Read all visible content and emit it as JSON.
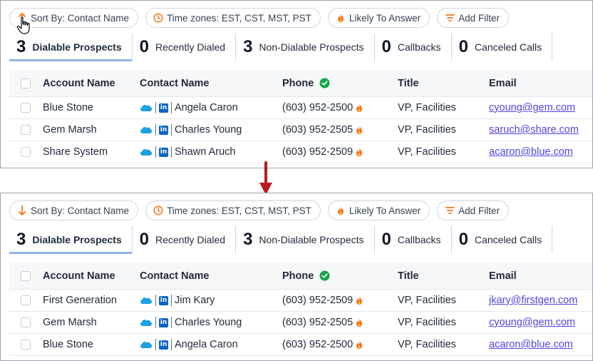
{
  "filters": {
    "sort_label": "Sort By: Contact Name",
    "timezones_label": "Time zones: EST, CST, MST, PST",
    "likely_label": "Likely To Answer",
    "add_filter_label": "Add Filter"
  },
  "tabs": [
    {
      "count": "3",
      "label": "Dialable Prospects"
    },
    {
      "count": "0",
      "label": "Recently Dialed"
    },
    {
      "count": "3",
      "label": "Non-Dialable Prospects"
    },
    {
      "count": "0",
      "label": "Callbacks"
    },
    {
      "count": "0",
      "label": "Canceled Calls"
    }
  ],
  "columns": {
    "account": "Account Name",
    "contact": "Contact Name",
    "phone": "Phone",
    "title": "Title",
    "email": "Email"
  },
  "before": {
    "rows": [
      {
        "account": "Blue Stone",
        "contact": "Angela Caron",
        "phone": "(603) 952-2500",
        "title": "VP, Facilities",
        "email": "cyoung@gem.com"
      },
      {
        "account": "Gem Marsh",
        "contact": "Charles Young",
        "phone": "(603) 952-2505",
        "title": "VP, Facilities",
        "email": "saruch@share.com"
      },
      {
        "account": "Share System",
        "contact": "Shawn Aruch",
        "phone": "(603) 952-2509",
        "title": "VP, Facilities",
        "email": "acaron@blue.com"
      }
    ]
  },
  "after": {
    "rows": [
      {
        "account": "First Generation",
        "contact": "Jim Kary",
        "phone": "(603) 952-2509",
        "title": "VP, Facilities",
        "email": "jkary@firstgen.com"
      },
      {
        "account": "Gem Marsh",
        "contact": "Charles Young",
        "phone": "(603) 952-2505",
        "title": "VP, Facilities",
        "email": "cyoung@gem.com"
      },
      {
        "account": "Blue Stone",
        "contact": "Angela Caron",
        "phone": "(603) 952-2500",
        "title": "VP, Facilities",
        "email": "acaron@blue.com"
      }
    ]
  },
  "icons": {
    "sort_up": "arrow-up-icon",
    "sort_down": "arrow-down-icon",
    "clock": "clock-icon",
    "flame": "flame-icon",
    "filter": "filter-icon",
    "verified": "check-circle-icon",
    "salesforce": "salesforce-icon",
    "linkedin": "linkedin-icon",
    "cursor": "hand-cursor-icon"
  },
  "colors": {
    "accent_orange": "#f97316",
    "active_tab_underline": "#93b4e8",
    "link": "#4f46e5",
    "verified_green": "#16a34a",
    "transition_arrow": "#b91c1c",
    "linkedin_blue": "#0a66c2",
    "salesforce_blue": "#1ba1e2"
  }
}
